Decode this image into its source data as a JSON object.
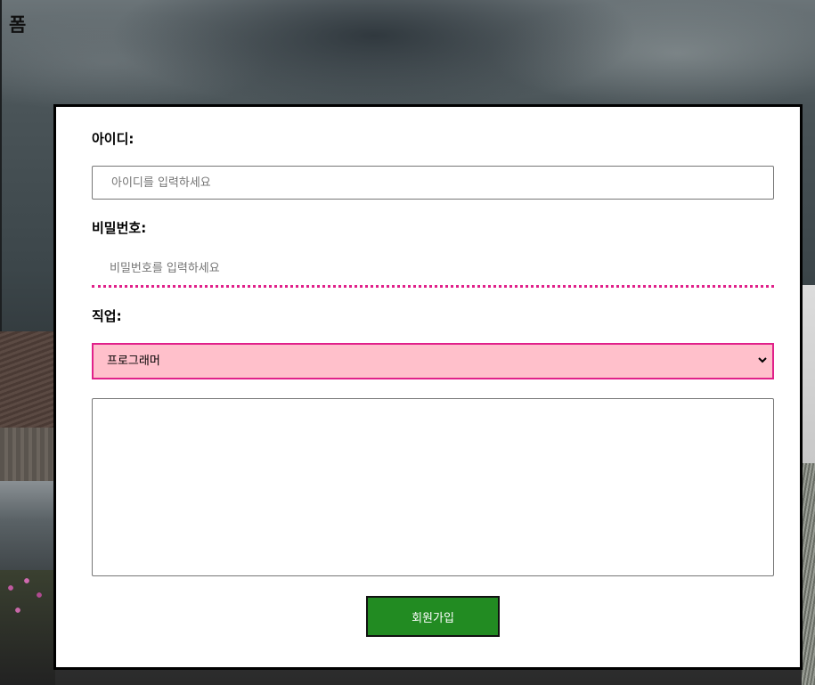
{
  "page": {
    "title": "폼"
  },
  "form": {
    "id_label": "아이디:",
    "id_placeholder": "아이디를 입력하세요",
    "password_label": "비밀번호:",
    "password_placeholder": "비밀번호를 입력하세요",
    "job_label": "직업:",
    "job_selected": "프로그래머",
    "memo_value": "",
    "submit_label": "회원가입"
  },
  "colors": {
    "accent_pink": "#e0218a",
    "select_background": "#ffc0cb",
    "submit_green": "#228b22"
  },
  "icons": {
    "select_arrow": "chevron-down-icon"
  }
}
